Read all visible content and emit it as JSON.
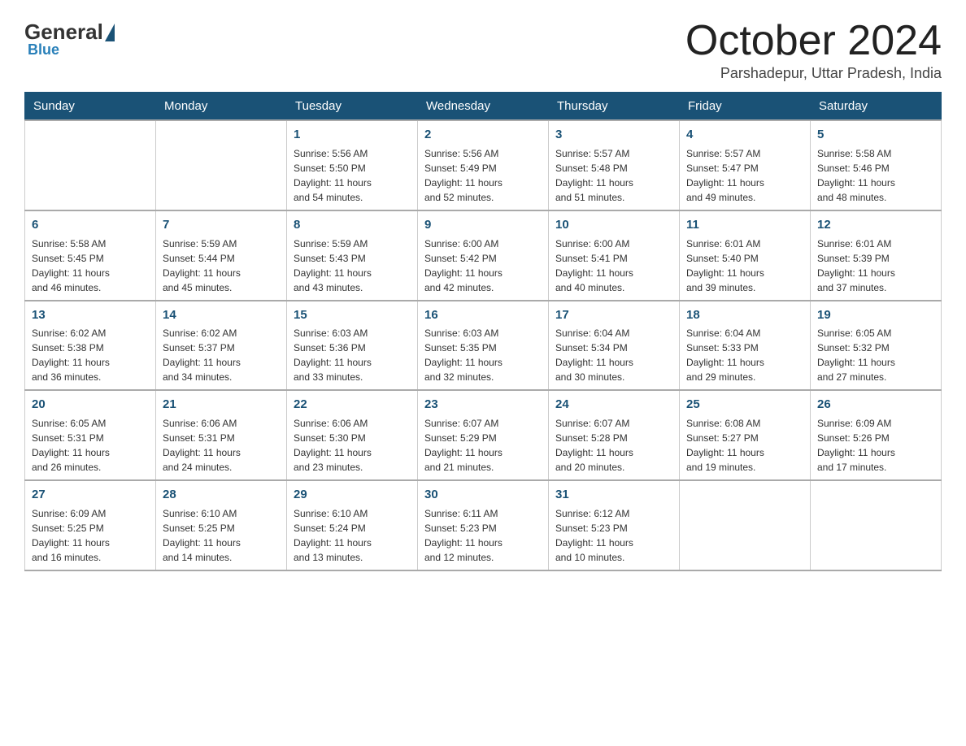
{
  "logo": {
    "general": "General",
    "blue": "Blue"
  },
  "header": {
    "month": "October 2024",
    "location": "Parshadepur, Uttar Pradesh, India"
  },
  "days_of_week": [
    "Sunday",
    "Monday",
    "Tuesday",
    "Wednesday",
    "Thursday",
    "Friday",
    "Saturday"
  ],
  "weeks": [
    [
      {
        "day": "",
        "info": ""
      },
      {
        "day": "",
        "info": ""
      },
      {
        "day": "1",
        "info": "Sunrise: 5:56 AM\nSunset: 5:50 PM\nDaylight: 11 hours\nand 54 minutes."
      },
      {
        "day": "2",
        "info": "Sunrise: 5:56 AM\nSunset: 5:49 PM\nDaylight: 11 hours\nand 52 minutes."
      },
      {
        "day": "3",
        "info": "Sunrise: 5:57 AM\nSunset: 5:48 PM\nDaylight: 11 hours\nand 51 minutes."
      },
      {
        "day": "4",
        "info": "Sunrise: 5:57 AM\nSunset: 5:47 PM\nDaylight: 11 hours\nand 49 minutes."
      },
      {
        "day": "5",
        "info": "Sunrise: 5:58 AM\nSunset: 5:46 PM\nDaylight: 11 hours\nand 48 minutes."
      }
    ],
    [
      {
        "day": "6",
        "info": "Sunrise: 5:58 AM\nSunset: 5:45 PM\nDaylight: 11 hours\nand 46 minutes."
      },
      {
        "day": "7",
        "info": "Sunrise: 5:59 AM\nSunset: 5:44 PM\nDaylight: 11 hours\nand 45 minutes."
      },
      {
        "day": "8",
        "info": "Sunrise: 5:59 AM\nSunset: 5:43 PM\nDaylight: 11 hours\nand 43 minutes."
      },
      {
        "day": "9",
        "info": "Sunrise: 6:00 AM\nSunset: 5:42 PM\nDaylight: 11 hours\nand 42 minutes."
      },
      {
        "day": "10",
        "info": "Sunrise: 6:00 AM\nSunset: 5:41 PM\nDaylight: 11 hours\nand 40 minutes."
      },
      {
        "day": "11",
        "info": "Sunrise: 6:01 AM\nSunset: 5:40 PM\nDaylight: 11 hours\nand 39 minutes."
      },
      {
        "day": "12",
        "info": "Sunrise: 6:01 AM\nSunset: 5:39 PM\nDaylight: 11 hours\nand 37 minutes."
      }
    ],
    [
      {
        "day": "13",
        "info": "Sunrise: 6:02 AM\nSunset: 5:38 PM\nDaylight: 11 hours\nand 36 minutes."
      },
      {
        "day": "14",
        "info": "Sunrise: 6:02 AM\nSunset: 5:37 PM\nDaylight: 11 hours\nand 34 minutes."
      },
      {
        "day": "15",
        "info": "Sunrise: 6:03 AM\nSunset: 5:36 PM\nDaylight: 11 hours\nand 33 minutes."
      },
      {
        "day": "16",
        "info": "Sunrise: 6:03 AM\nSunset: 5:35 PM\nDaylight: 11 hours\nand 32 minutes."
      },
      {
        "day": "17",
        "info": "Sunrise: 6:04 AM\nSunset: 5:34 PM\nDaylight: 11 hours\nand 30 minutes."
      },
      {
        "day": "18",
        "info": "Sunrise: 6:04 AM\nSunset: 5:33 PM\nDaylight: 11 hours\nand 29 minutes."
      },
      {
        "day": "19",
        "info": "Sunrise: 6:05 AM\nSunset: 5:32 PM\nDaylight: 11 hours\nand 27 minutes."
      }
    ],
    [
      {
        "day": "20",
        "info": "Sunrise: 6:05 AM\nSunset: 5:31 PM\nDaylight: 11 hours\nand 26 minutes."
      },
      {
        "day": "21",
        "info": "Sunrise: 6:06 AM\nSunset: 5:31 PM\nDaylight: 11 hours\nand 24 minutes."
      },
      {
        "day": "22",
        "info": "Sunrise: 6:06 AM\nSunset: 5:30 PM\nDaylight: 11 hours\nand 23 minutes."
      },
      {
        "day": "23",
        "info": "Sunrise: 6:07 AM\nSunset: 5:29 PM\nDaylight: 11 hours\nand 21 minutes."
      },
      {
        "day": "24",
        "info": "Sunrise: 6:07 AM\nSunset: 5:28 PM\nDaylight: 11 hours\nand 20 minutes."
      },
      {
        "day": "25",
        "info": "Sunrise: 6:08 AM\nSunset: 5:27 PM\nDaylight: 11 hours\nand 19 minutes."
      },
      {
        "day": "26",
        "info": "Sunrise: 6:09 AM\nSunset: 5:26 PM\nDaylight: 11 hours\nand 17 minutes."
      }
    ],
    [
      {
        "day": "27",
        "info": "Sunrise: 6:09 AM\nSunset: 5:25 PM\nDaylight: 11 hours\nand 16 minutes."
      },
      {
        "day": "28",
        "info": "Sunrise: 6:10 AM\nSunset: 5:25 PM\nDaylight: 11 hours\nand 14 minutes."
      },
      {
        "day": "29",
        "info": "Sunrise: 6:10 AM\nSunset: 5:24 PM\nDaylight: 11 hours\nand 13 minutes."
      },
      {
        "day": "30",
        "info": "Sunrise: 6:11 AM\nSunset: 5:23 PM\nDaylight: 11 hours\nand 12 minutes."
      },
      {
        "day": "31",
        "info": "Sunrise: 6:12 AM\nSunset: 5:23 PM\nDaylight: 11 hours\nand 10 minutes."
      },
      {
        "day": "",
        "info": ""
      },
      {
        "day": "",
        "info": ""
      }
    ]
  ]
}
